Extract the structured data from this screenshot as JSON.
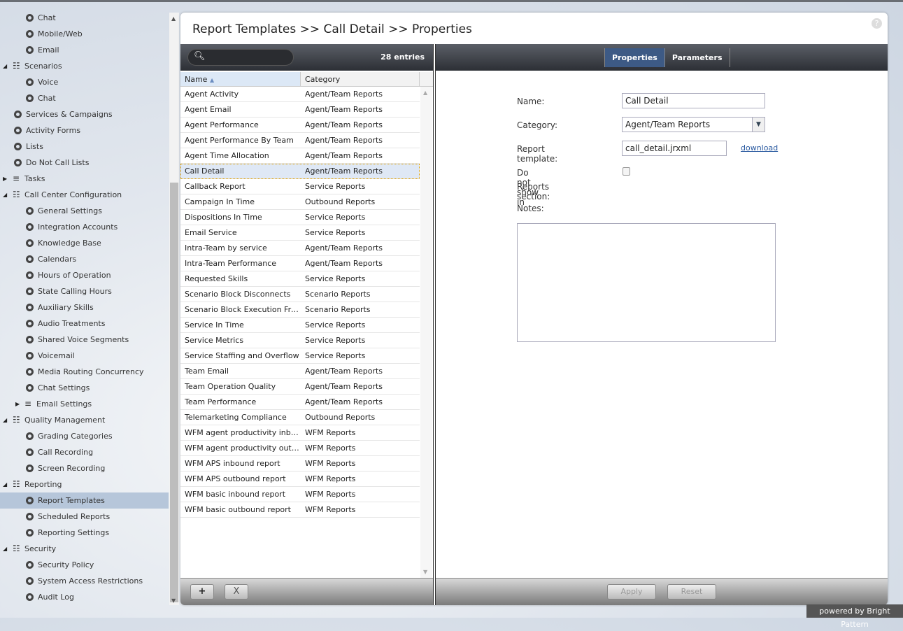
{
  "sidebar": {
    "items": [
      {
        "label": "Chat",
        "level": 2,
        "type": "leaf"
      },
      {
        "label": "Mobile/Web",
        "level": 2,
        "type": "leaf"
      },
      {
        "label": "Email",
        "level": 2,
        "type": "leaf"
      },
      {
        "label": "Scenarios",
        "level": 1,
        "type": "group-open"
      },
      {
        "label": "Voice",
        "level": 2,
        "type": "leaf"
      },
      {
        "label": "Chat",
        "level": 2,
        "type": "leaf"
      },
      {
        "label": "Services & Campaigns",
        "level": 1,
        "type": "leaf"
      },
      {
        "label": "Activity Forms",
        "level": 1,
        "type": "leaf"
      },
      {
        "label": "Lists",
        "level": 1,
        "type": "leaf"
      },
      {
        "label": "Do Not Call Lists",
        "level": 1,
        "type": "leaf"
      },
      {
        "label": "Tasks",
        "level": 1,
        "type": "group-closed"
      },
      {
        "label": "Call Center Configuration",
        "level": 1,
        "type": "group-open"
      },
      {
        "label": "General Settings",
        "level": 2,
        "type": "leaf"
      },
      {
        "label": "Integration Accounts",
        "level": 2,
        "type": "leaf"
      },
      {
        "label": "Knowledge Base",
        "level": 2,
        "type": "leaf"
      },
      {
        "label": "Calendars",
        "level": 2,
        "type": "leaf"
      },
      {
        "label": "Hours of Operation",
        "level": 2,
        "type": "leaf"
      },
      {
        "label": "State Calling Hours",
        "level": 2,
        "type": "leaf"
      },
      {
        "label": "Auxiliary Skills",
        "level": 2,
        "type": "leaf"
      },
      {
        "label": "Audio Treatments",
        "level": 2,
        "type": "leaf"
      },
      {
        "label": "Shared Voice Segments",
        "level": 2,
        "type": "leaf"
      },
      {
        "label": "Voicemail",
        "level": 2,
        "type": "leaf"
      },
      {
        "label": "Media Routing Concurrency",
        "level": 2,
        "type": "leaf"
      },
      {
        "label": "Chat Settings",
        "level": 2,
        "type": "leaf"
      },
      {
        "label": "Email Settings",
        "level": 2,
        "type": "group-closed"
      },
      {
        "label": "Quality Management",
        "level": 1,
        "type": "group-open"
      },
      {
        "label": "Grading Categories",
        "level": 2,
        "type": "leaf"
      },
      {
        "label": "Call Recording",
        "level": 2,
        "type": "leaf"
      },
      {
        "label": "Screen Recording",
        "level": 2,
        "type": "leaf"
      },
      {
        "label": "Reporting",
        "level": 1,
        "type": "group-open"
      },
      {
        "label": "Report Templates",
        "level": 2,
        "type": "leaf",
        "selected": true
      },
      {
        "label": "Scheduled Reports",
        "level": 2,
        "type": "leaf"
      },
      {
        "label": "Reporting Settings",
        "level": 2,
        "type": "leaf"
      },
      {
        "label": "Security",
        "level": 1,
        "type": "group-open"
      },
      {
        "label": "Security Policy",
        "level": 2,
        "type": "leaf"
      },
      {
        "label": "System Access Restrictions",
        "level": 2,
        "type": "leaf"
      },
      {
        "label": "Audit Log",
        "level": 2,
        "type": "leaf"
      }
    ]
  },
  "header": {
    "title": "Report Templates >> Call Detail >> Properties",
    "help": "?"
  },
  "list": {
    "search_icon": "search-icon",
    "entries": "28 entries",
    "columns": {
      "name": "Name",
      "sort": "▲",
      "category": "Category"
    },
    "rows": [
      [
        "Agent Activity",
        "Agent/Team Reports"
      ],
      [
        "Agent Email",
        "Agent/Team Reports"
      ],
      [
        "Agent Performance",
        "Agent/Team Reports"
      ],
      [
        "Agent Performance By Team",
        "Agent/Team Reports"
      ],
      [
        "Agent Time Allocation",
        "Agent/Team Reports"
      ],
      [
        "Call Detail",
        "Agent/Team Reports"
      ],
      [
        "Callback Report",
        "Service Reports"
      ],
      [
        "Campaign In Time",
        "Outbound Reports"
      ],
      [
        "Dispositions In Time",
        "Service Reports"
      ],
      [
        "Email Service",
        "Service Reports"
      ],
      [
        "Intra-Team by service",
        "Agent/Team Reports"
      ],
      [
        "Intra-Team Performance",
        "Agent/Team Reports"
      ],
      [
        "Requested Skills",
        "Service Reports"
      ],
      [
        "Scenario Block Disconnects",
        "Scenario Reports"
      ],
      [
        "Scenario Block Execution Frequency",
        "Scenario Reports"
      ],
      [
        "Service In Time",
        "Service Reports"
      ],
      [
        "Service Metrics",
        "Service Reports"
      ],
      [
        "Service Staffing and Overflow",
        "Service Reports"
      ],
      [
        "Team Email",
        "Agent/Team Reports"
      ],
      [
        "Team Operation Quality",
        "Agent/Team Reports"
      ],
      [
        "Team Performance",
        "Agent/Team Reports"
      ],
      [
        "Telemarketing Compliance",
        "Outbound Reports"
      ],
      [
        "WFM agent productivity inbound report",
        "WFM Reports"
      ],
      [
        "WFM agent productivity outbound report",
        "WFM Reports"
      ],
      [
        "WFM APS inbound report",
        "WFM Reports"
      ],
      [
        "WFM APS outbound report",
        "WFM Reports"
      ],
      [
        "WFM basic inbound report",
        "WFM Reports"
      ],
      [
        "WFM basic outbound report",
        "WFM Reports"
      ]
    ],
    "selected_index": 5,
    "add": "+",
    "delete": "X"
  },
  "tabs": [
    {
      "label": "Properties",
      "active": true
    },
    {
      "label": "Parameters",
      "active": false
    }
  ],
  "form": {
    "name_label": "Name:",
    "name_value": "Call Detail",
    "category_label": "Category:",
    "category_value": "Agent/Team Reports",
    "template_label": "Report template:",
    "template_value": "call_detail.jrxml",
    "download": "download",
    "hide_label_1": "Do not show in",
    "hide_label_2": "Reports section:",
    "hide_checked": false,
    "notes_label": "Notes:",
    "notes_value": ""
  },
  "actions": {
    "apply": "Apply",
    "reset": "Reset"
  },
  "footer": "powered by Bright Pattern",
  "colors": {
    "selected_tab": "#3d5a85",
    "selected_row": "#dfe8f5",
    "sidebar_selected": "#b6c6da"
  }
}
